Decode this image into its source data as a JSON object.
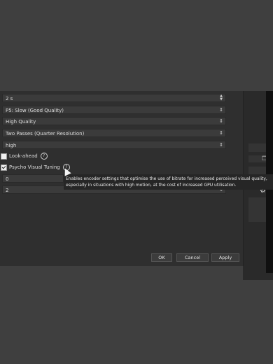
{
  "fields": {
    "keyframe_interval": "2 s",
    "preset": "P5: Slow (Good Quality)",
    "tuning": "High Quality",
    "multipass": "Two Passes (Quarter Resolution)",
    "profile": "high",
    "gpu": "0",
    "max_bframes": "2"
  },
  "checkboxes": {
    "lookahead_label": "Look-ahead",
    "lookahead_checked": false,
    "psycho_label": "Psycho Visual Tuning",
    "psycho_checked": true
  },
  "help_glyph": "?",
  "tooltip": {
    "line1": "Enables encoder settings that optimise the use of bitrate for increased perceived visual quality,",
    "line2": "especially in situations with high motion, at the cost of increased GPU utilisation."
  },
  "buttons": {
    "ok": "OK",
    "cancel": "Cancel",
    "apply": "Apply"
  },
  "icons": {
    "combo": "chevron-updown-icon",
    "spin": "spin-arrows-icon",
    "gear": "gear-icon",
    "copy": "copy-icon"
  }
}
